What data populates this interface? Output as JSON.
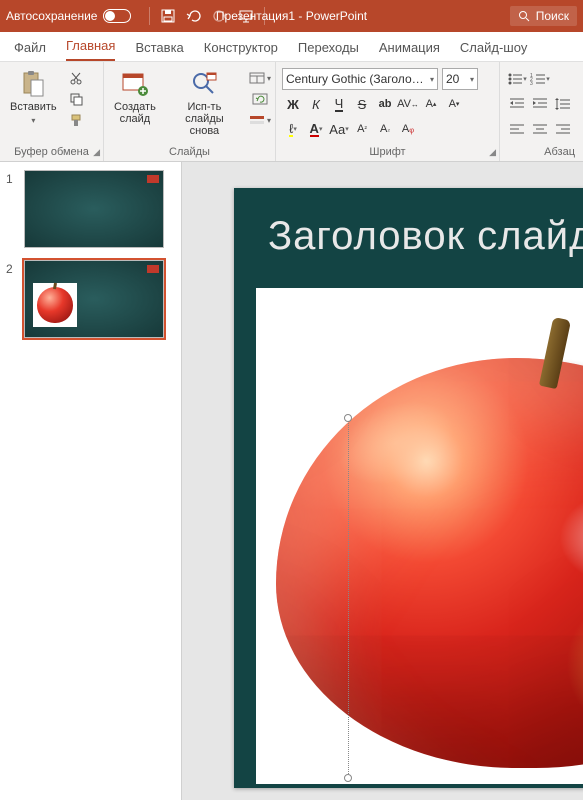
{
  "titlebar": {
    "autosave_label": "Автосохранение",
    "doc_title": "Презентация1 - PowerPoint",
    "search_label": "Поиск"
  },
  "tabs": {
    "file": "Файл",
    "home": "Главная",
    "insert": "Вставка",
    "design": "Конструктор",
    "transitions": "Переходы",
    "animations": "Анимация",
    "slideshow": "Слайд-шоу"
  },
  "ribbon": {
    "clipboard": {
      "paste": "Вставить",
      "group_label": "Буфер обмена"
    },
    "slides": {
      "new_slide": "Создать\nслайд",
      "reuse_slides": "Исп-ть\nслайды снова",
      "group_label": "Слайды"
    },
    "font": {
      "font_name": "Century Gothic (Заголовки)",
      "font_size": "20",
      "bold": "Ж",
      "italic": "К",
      "underline": "Ч",
      "strike": "S",
      "shadow_ab": "ab",
      "spacing": "AV",
      "case": "Aa",
      "group_label": "Шрифт"
    },
    "paragraph": {
      "group_label": "Абзац"
    }
  },
  "slide_panel": {
    "thumbnails": [
      {
        "num": "1",
        "selected": false,
        "has_image": false
      },
      {
        "num": "2",
        "selected": true,
        "has_image": true
      }
    ]
  },
  "slide": {
    "title_text": "Заголовок слайда"
  }
}
